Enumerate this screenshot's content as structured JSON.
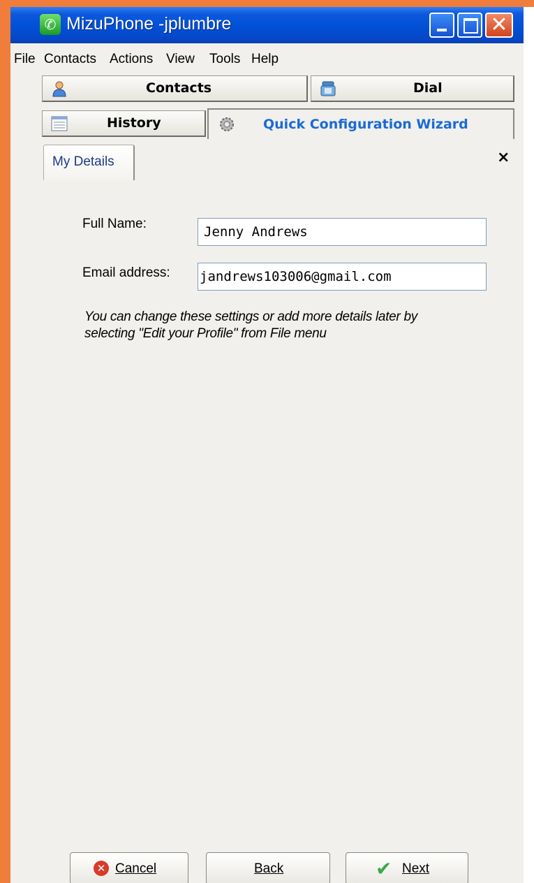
{
  "window": {
    "title": "MizuPhone -jplumbre",
    "controls": {
      "minimize": "minimize-icon",
      "maximize": "maximize-icon",
      "close": "close-icon"
    }
  },
  "menu": {
    "items": [
      {
        "label": "File"
      },
      {
        "label": "Contacts"
      },
      {
        "label": "Actions"
      },
      {
        "label": "View"
      },
      {
        "label": "Tools"
      },
      {
        "label": "Help"
      }
    ]
  },
  "nav": {
    "contacts_label": "Contacts",
    "dial_label": "Dial",
    "history_label": "History",
    "wizard_label": "Quick Configuration Wizard"
  },
  "tabs": {
    "my_details_label": "My Details",
    "close_symbol": "×"
  },
  "form": {
    "full_name_label": "Full Name:",
    "full_name_value": "Jenny Andrews",
    "email_label": "Email address:",
    "email_value": "jandrews103006@gmail.com",
    "hint_line1": "You can change these settings or add more details later by",
    "hint_line2": "selecting \"Edit your Profile\" from File menu"
  },
  "buttons": {
    "cancel_label": "Cancel",
    "back_label": "Back",
    "next_label": "Next"
  },
  "colors": {
    "frame_accent": "#f07d3c",
    "titlebar": "#0150d8",
    "wizard_text": "#1a6ad8",
    "cancel_icon": "#d93a2b",
    "next_check": "#3aa84a"
  }
}
